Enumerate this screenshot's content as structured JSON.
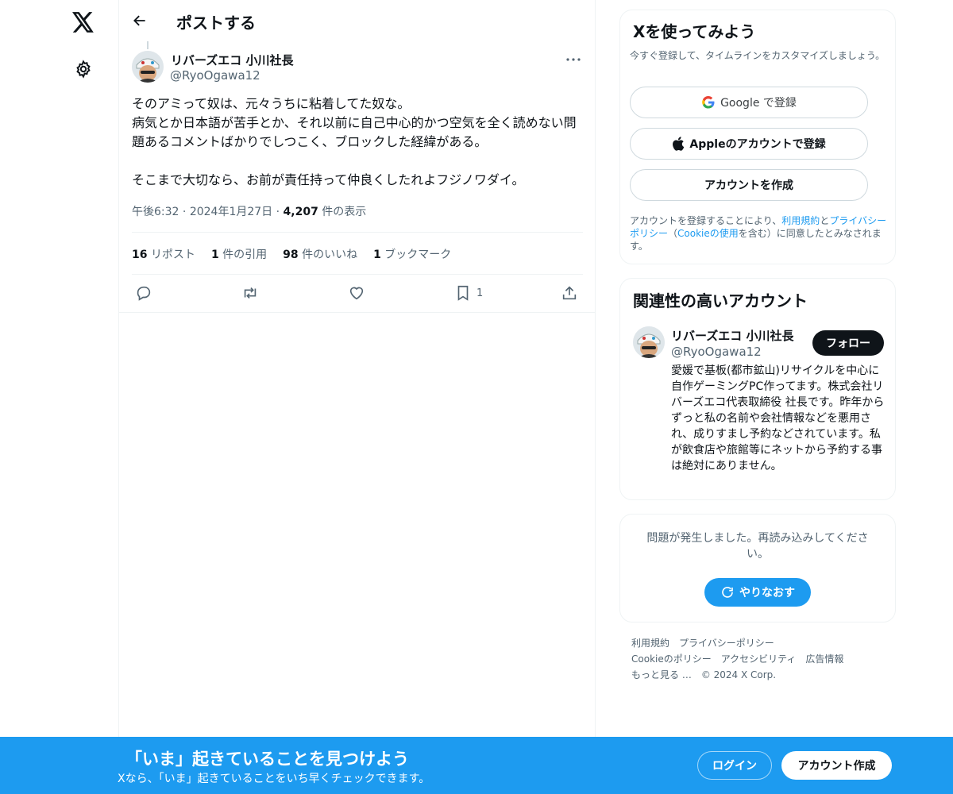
{
  "nav": {
    "logo_icon": "x-logo-icon",
    "settings_icon": "gear-icon"
  },
  "header": {
    "title": "ポストする"
  },
  "tweet": {
    "author_name": "リバーズエコ 小川社長",
    "author_handle": "@RyoOgawa12",
    "text": "そのアミって奴は、元々うちに粘着してた奴な。\n病気とか日本語が苦手とか、それ以前に自己中心的かつ空気を全く読めない問題あるコメントばかりでしつこく、ブロックした経緯がある。\n\nそこまで大切なら、お前が責任持って仲良くしたれよフジノワダイ。",
    "time": "午後6:32",
    "date": "2024年1月27日",
    "views_count": "4,207",
    "views_label": "件の表示",
    "stats": {
      "reposts_count": "16",
      "reposts_label": "リポスト",
      "quotes_count": "1",
      "quotes_label": "件の引用",
      "likes_count": "98",
      "likes_label": "件のいいね",
      "bookmarks_count": "1",
      "bookmarks_label": "ブックマーク"
    },
    "actions": {
      "bookmark_count": "1"
    }
  },
  "signup": {
    "title": "Xを使ってみよう",
    "subtitle": "今すぐ登録して、タイムラインをカスタマイズしましょう。",
    "google_label": "Google で登録",
    "apple_label": "Appleのアカウントで登録",
    "create_label": "アカウントを作成",
    "terms_prefix": "アカウントを登録することにより、",
    "terms_link": "利用規約",
    "terms_and": "と",
    "privacy_link": "プライバシーポリシー",
    "terms_mid": "（",
    "cookie_link": "Cookieの使用",
    "terms_suffix": "を含む）に同意したとみなされます。"
  },
  "related": {
    "title": "関連性の高いアカウント",
    "name": "リバーズエコ 小川社長",
    "handle": "@RyoOgawa12",
    "follow_label": "フォロー",
    "bio": "愛媛で基板(都市鉱山)リサイクルを中心に自作ゲーミングPC作ってます。株式会社リバーズエコ代表取締役 社長です。昨年からずっと私の名前や会社情報などを悪用され、成りすまし予約などされています。私が飲食店や旅館等にネットから予約する事は絶対にありません。"
  },
  "error": {
    "message": "問題が発生しました。再読み込みしてください。",
    "retry_label": "やりなおす"
  },
  "footer": {
    "terms": "利用規約",
    "privacy": "プライバシーポリシー",
    "cookie": "Cookieのポリシー",
    "accessibility": "アクセシビリティ",
    "ads": "広告情報",
    "more": "もっと見る …",
    "copyright": "© 2024 X Corp."
  },
  "banner": {
    "title": "「いま」起きていることを見つけよう",
    "subtitle": "Xなら、「いま」起きていることをいち早くチェックできます。",
    "login_label": "ログイン",
    "signup_label": "アカウント作成"
  },
  "colors": {
    "accent": "#1d9bf0",
    "text": "#0f1419",
    "muted": "#536471",
    "border": "#eff3f4"
  }
}
